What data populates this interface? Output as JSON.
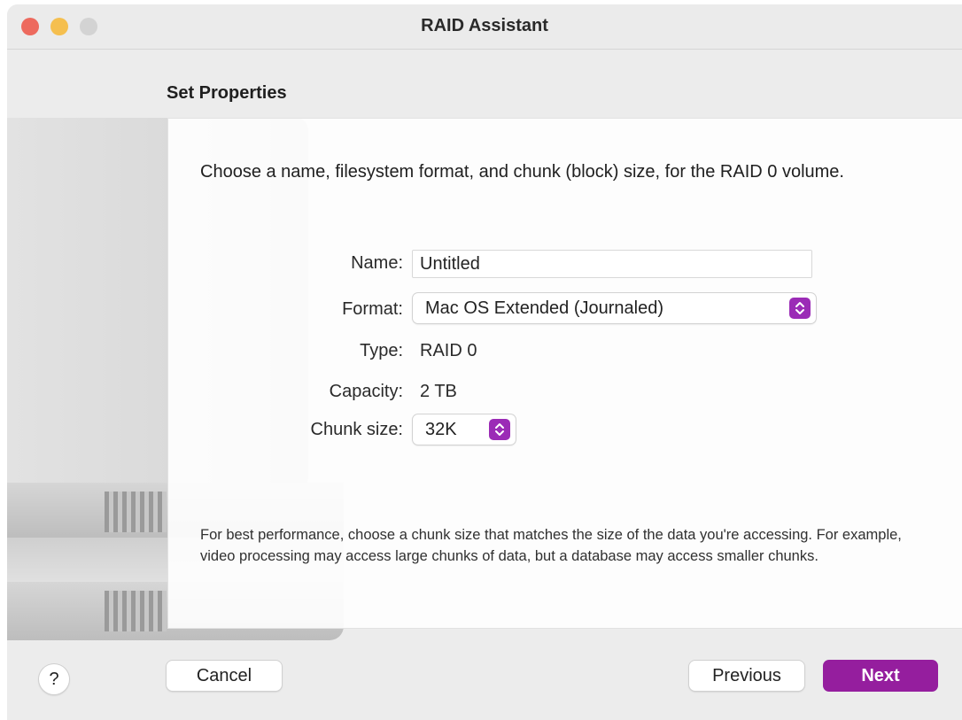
{
  "window": {
    "title": "RAID Assistant"
  },
  "page": {
    "section_title": "Set Properties"
  },
  "content": {
    "intro": "Choose a name, filesystem format, and chunk (block) size, for the RAID 0 volume.",
    "name_label": "Name:",
    "name_value": "Untitled",
    "format_label": "Format:",
    "format_value": "Mac OS Extended (Journaled)",
    "type_label": "Type:",
    "type_value": "RAID 0",
    "capacity_label": "Capacity:",
    "capacity_value": "2 TB",
    "chunk_label": "Chunk size:",
    "chunk_value": "32K",
    "hint": "For best performance, choose a chunk size that matches the size of the data you're accessing. For example, video processing may access large chunks of data, but a database may access smaller chunks."
  },
  "footer": {
    "help_label": "?",
    "cancel_label": "Cancel",
    "previous_label": "Previous",
    "next_label": "Next"
  },
  "colors": {
    "accent": "#951e9e",
    "close": "#ed6a5e",
    "minimize": "#f5bf4f",
    "zoom_disabled": "#d3d3d3"
  },
  "icons": {
    "stepper": "chevron-up-down-icon",
    "help": "question-mark-icon"
  }
}
